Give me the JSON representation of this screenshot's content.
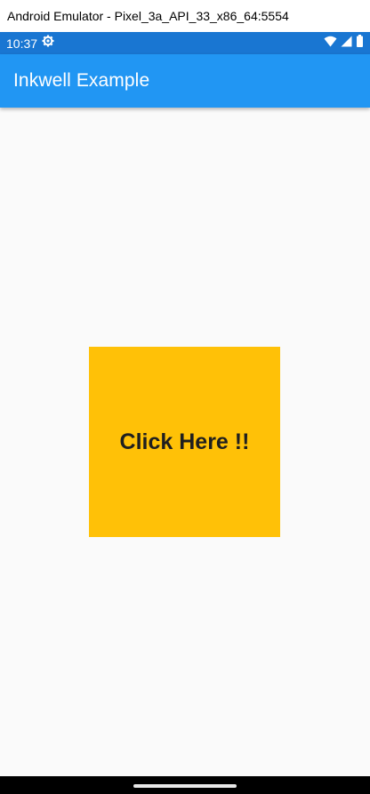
{
  "window": {
    "title": "Android Emulator - Pixel_3a_API_33_x86_64:5554"
  },
  "status_bar": {
    "time": "10:37",
    "color": "#1976d2",
    "icons": [
      "settings-gear-icon",
      "wifi-icon",
      "cellular-signal-icon",
      "battery-icon"
    ]
  },
  "app_bar": {
    "title": "Inkwell Example",
    "color": "#2196f3"
  },
  "main": {
    "inkwell": {
      "label": "Click Here !!",
      "color": "#ffc107"
    }
  },
  "nav_bar": {
    "handle": "gesture-handle"
  }
}
